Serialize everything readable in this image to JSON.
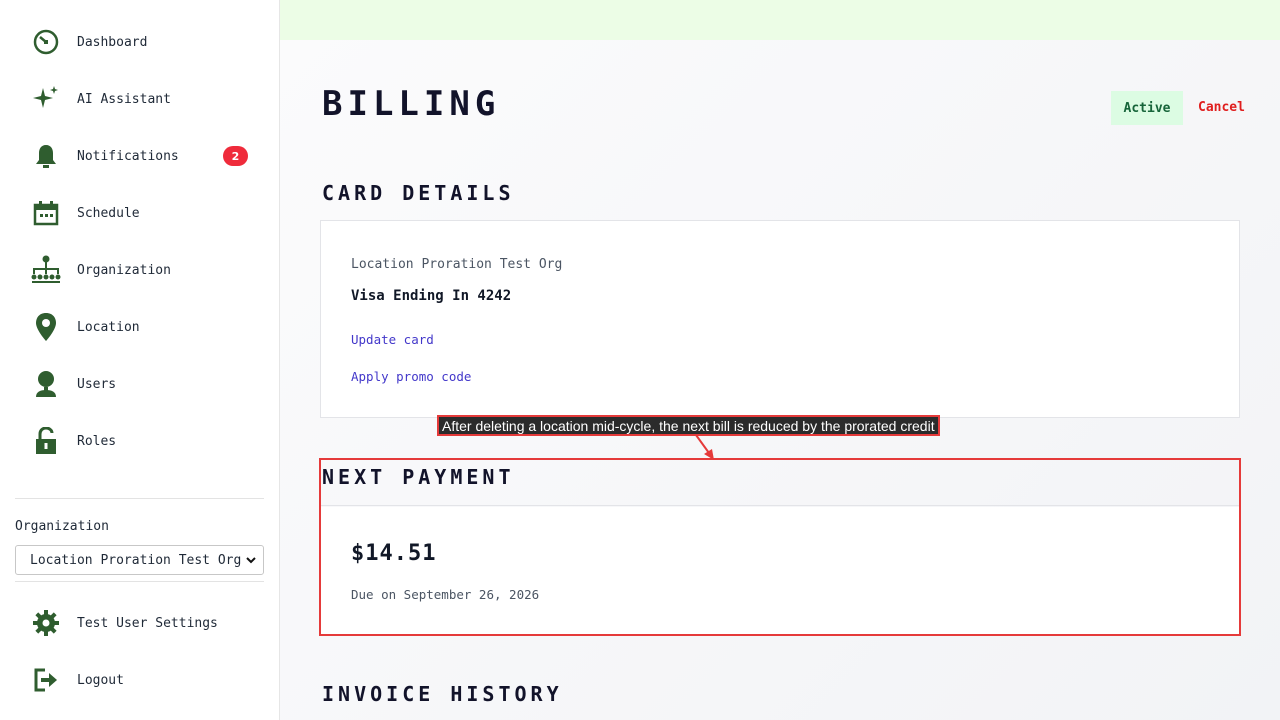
{
  "sidebar": {
    "nav_items": [
      {
        "label": "Dashboard",
        "icon": "dashboard-icon"
      },
      {
        "label": "AI Assistant",
        "icon": "sparkle-icon"
      },
      {
        "label": "Notifications",
        "icon": "bell-icon",
        "badge": "2"
      },
      {
        "label": "Schedule",
        "icon": "calendar-icon"
      },
      {
        "label": "Organization",
        "icon": "org-chart-icon"
      },
      {
        "label": "Location",
        "icon": "map-pin-icon"
      },
      {
        "label": "Users",
        "icon": "user-icon"
      },
      {
        "label": "Roles",
        "icon": "lock-icon"
      }
    ],
    "org_label": "Organization",
    "org_select_value": "Location Proration Test Org",
    "settings_label": "Test User Settings",
    "logout_label": "Logout"
  },
  "header": {
    "title": "BILLING",
    "status": "Active",
    "cancel_label": "Cancel"
  },
  "card_details": {
    "title": "CARD DETAILS",
    "org_name": "Location Proration Test Org",
    "card_description": "Visa Ending In 4242",
    "update_card_label": "Update card",
    "promo_label": "Apply promo code"
  },
  "next_payment": {
    "title": "NEXT PAYMENT",
    "amount": "$14.51",
    "due_text": "Due on September 26, 2026"
  },
  "annotation": {
    "text": "After deleting a location mid-cycle, the next bill is reduced by the prorated credit"
  },
  "invoice_history": {
    "title": "INVOICE HISTORY"
  },
  "colors": {
    "icon_green": "#2f5d2f",
    "badge_red": "#ef2b3b",
    "link_blue": "#4338ca",
    "cancel_red": "#e01e1e",
    "active_bg": "#dcfce3",
    "highlight_red": "#e53a3a"
  }
}
